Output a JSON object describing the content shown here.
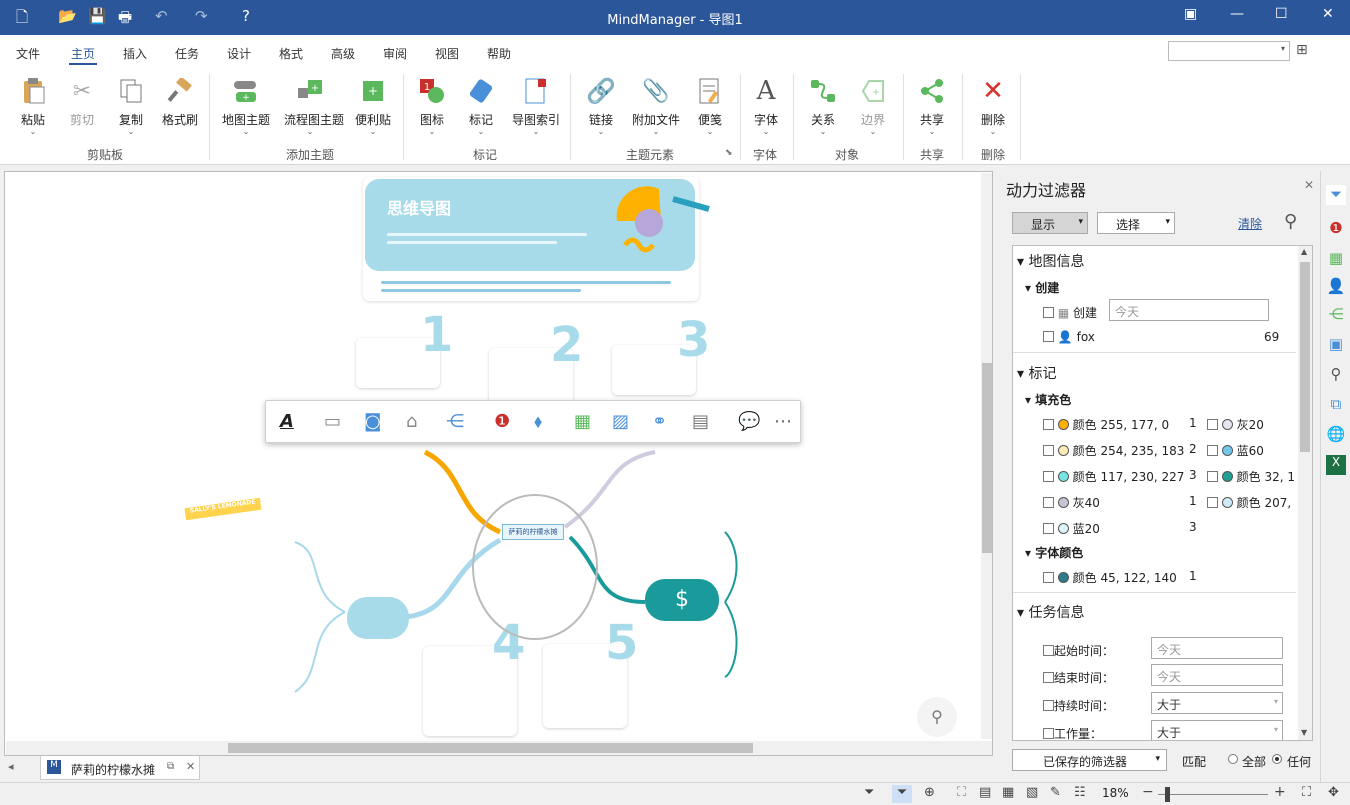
{
  "app": {
    "title": "MindManager - 导图1"
  },
  "menu": {
    "tabs": [
      "文件",
      "主页",
      "插入",
      "任务",
      "设计",
      "格式",
      "高级",
      "审阅",
      "视图",
      "帮助"
    ],
    "active": "主页"
  },
  "ribbon": {
    "buttons": {
      "paste": "粘贴",
      "cut": "剪切",
      "copy": "复制",
      "format_painter": "格式刷",
      "map_topic": "地图主题",
      "flow_topic": "流程图主题",
      "sticky": "便利贴",
      "icons": "图标",
      "tags": "标记",
      "index": "导图索引",
      "link": "链接",
      "attach": "附加文件",
      "notes": "便笺",
      "font": "字体",
      "relationship": "关系",
      "boundary": "边界",
      "share": "共享",
      "delete": "删除"
    },
    "groups": {
      "clipboard": "剪贴板",
      "add_topic": "添加主题",
      "markers": "标记",
      "topic_elements": "主题元素",
      "font": "字体",
      "objects": "对象",
      "share": "共享",
      "delete": "删除"
    }
  },
  "canvas": {
    "header_title": "思维导图",
    "central_topic": "萨莉的柠檬水摊",
    "numbers": [
      "1",
      "2",
      "3",
      "4",
      "5"
    ],
    "lemonade_banner": "SALLY'S LEMONADE"
  },
  "doc_tab": {
    "label": "萨莉的柠檬水摊"
  },
  "panel": {
    "title": "动力过滤器",
    "show_btn": "显示",
    "select_btn": "选择",
    "clear_link": "清除",
    "map_info": "地图信息",
    "created_section": "创建",
    "created_label": "创建",
    "created_placeholder": "今天",
    "author": "fox",
    "author_count": "69",
    "markers": "标记",
    "fill_color": "填充色",
    "fill_items": [
      {
        "label": "颜色 255, 177, 0",
        "count": "1",
        "color": "#ffb100"
      },
      {
        "label": "颜色 254, 235, 183",
        "count": "2",
        "color": "#feebb7"
      },
      {
        "label": "颜色 117, 230, 227",
        "count": "3",
        "color": "#75e6e3"
      },
      {
        "label": "灰40",
        "count": "1",
        "color": "#c8c4d6"
      },
      {
        "label": "蓝20",
        "count": "3",
        "color": "#d9f4fb"
      }
    ],
    "fill_items_right": [
      {
        "label": "灰20",
        "color": "#e6e4ee"
      },
      {
        "label": "蓝60",
        "color": "#74c7ec"
      },
      {
        "label": "颜色 32, 1",
        "color": "#20a090"
      },
      {
        "label": "颜色 207,",
        "color": "#cfeaf8"
      }
    ],
    "font_color": "字体颜色",
    "font_items": [
      {
        "label": "颜色 45, 122, 140",
        "count": "1",
        "color": "#2d7a8c"
      }
    ],
    "task_info": "任务信息",
    "start_time": "起始时间：",
    "end_time": "结束时间：",
    "duration": "持续时间：",
    "workload": "工作量：",
    "today": "今天",
    "greater": "大于",
    "saved_filters": "已保存的筛选器",
    "match": "匹配",
    "all": "全部",
    "any": "任何"
  },
  "status": {
    "zoom": "18%"
  },
  "colors": {
    "titlebar": "#2b579a",
    "accent": "#2b579a",
    "teal": "#1a9a9a"
  }
}
